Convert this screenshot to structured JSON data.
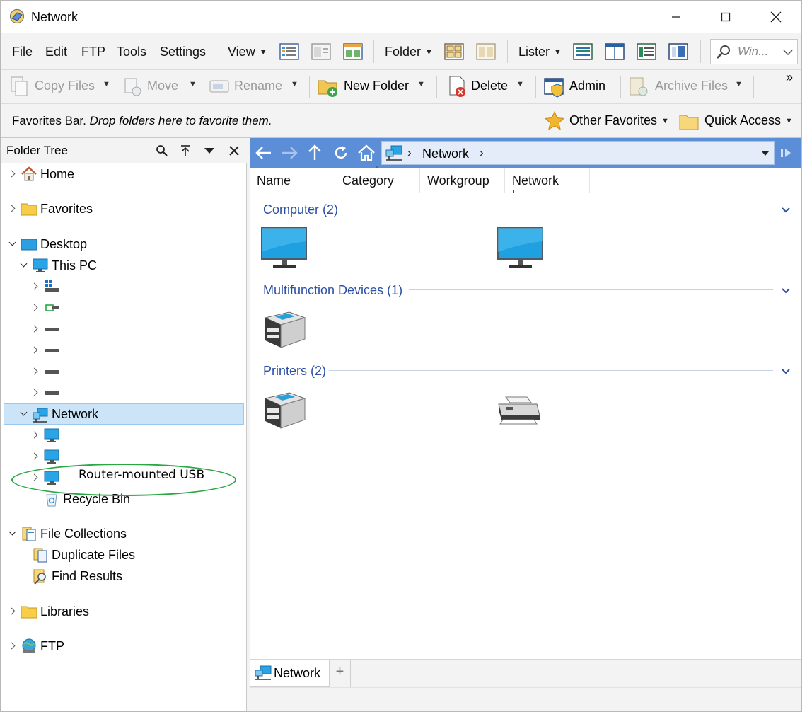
{
  "window": {
    "title": "Network"
  },
  "menu": {
    "items": [
      "File",
      "Edit",
      "FTP",
      "Tools",
      "Settings"
    ],
    "view": "View",
    "folder": "Folder",
    "lister": "Lister",
    "search_placeholder": "Win..."
  },
  "toolbar": {
    "copy_files": "Copy Files",
    "move": "Move",
    "rename": "Rename",
    "new_folder": "New Folder",
    "delete": "Delete",
    "admin": "Admin",
    "archive_files": "Archive Files",
    "overflow": "»"
  },
  "favbar": {
    "label": "Favorites Bar.",
    "hint": "Drop folders here to favorite them.",
    "other_favorites": "Other Favorites",
    "quick_access": "Quick Access"
  },
  "tree": {
    "header": "Folder Tree",
    "items": {
      "home": "Home",
      "favorites": "Favorites",
      "desktop": "Desktop",
      "this_pc": "This PC",
      "network": "Network",
      "recycle_bin": "Recycle Bin",
      "file_collections": "File Collections",
      "duplicate_files": "Duplicate Files",
      "find_results": "Find Results",
      "libraries": "Libraries",
      "ftp": "FTP"
    }
  },
  "address": {
    "crumb": "Network"
  },
  "columns": [
    "Name",
    "Category",
    "Workgroup",
    "Network lo..."
  ],
  "groups": [
    {
      "title": "Computer (2)"
    },
    {
      "title": "Multifunction Devices (1)"
    },
    {
      "title": "Printers (2)"
    }
  ],
  "tabs": {
    "active": "Network",
    "add": "+"
  },
  "annotation": {
    "text": "Router-mounted USB",
    "color": "#2aa745"
  },
  "colors": {
    "nav_bar": "#5b8ed6",
    "group_title": "#2a4fa5",
    "selection": "#cce4f7"
  }
}
